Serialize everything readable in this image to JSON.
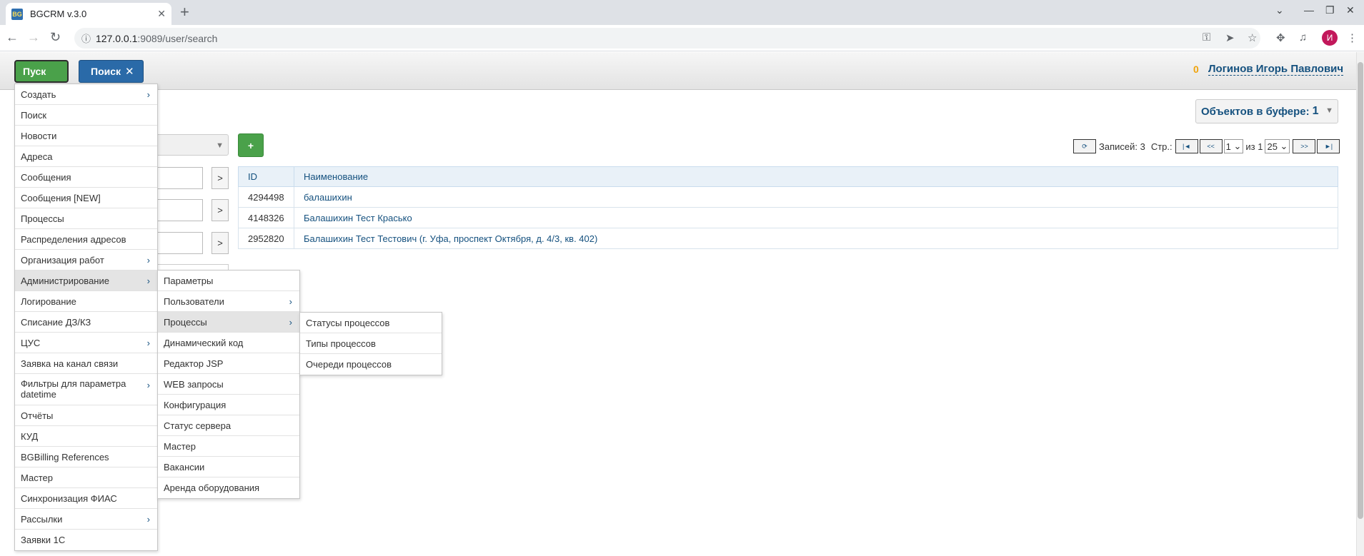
{
  "browser": {
    "tab_title": "BGCRM v.3.0",
    "favicon_text": "BG",
    "new_tab": "+",
    "url_host": "127.0.0.1",
    "url_rest": ":9089/user/search",
    "profile_initial": "И"
  },
  "header": {
    "start_label": "Пуск",
    "search_tab_label": "Поиск",
    "counter": "0",
    "user_name": "Логинов Игорь Павлович"
  },
  "buffer": {
    "label": "Объектов в буфере:",
    "count": "1"
  },
  "filter": {
    "add_label": "+",
    "go_label": ">"
  },
  "pager": {
    "records_label": "Записей: 3",
    "page_label": "Стр.:",
    "page_current": "1",
    "of_label": "из 1",
    "page_size": "25",
    "first": "|◄",
    "prev": "<<",
    "next": ">>",
    "last": "►|"
  },
  "table": {
    "headers": [
      "ID",
      "Наименование"
    ],
    "rows": [
      {
        "id": "4294498",
        "name": "балашихин"
      },
      {
        "id": "4148326",
        "name": "Балашихин Тест Красько"
      },
      {
        "id": "2952820",
        "name": "Балашихин Тест Тестович (г. Уфа, проспект Октября, д. 4/3, кв. 402)"
      }
    ]
  },
  "menu": {
    "main": [
      {
        "label": "Создать"
      },
      {
        "label": "Поиск"
      },
      {
        "label": "Новости"
      },
      {
        "label": "Адреса"
      },
      {
        "label": "Сообщения"
      },
      {
        "label": "Сообщения [NEW]"
      },
      {
        "label": "Процессы"
      },
      {
        "label": "Распределения адресов"
      },
      {
        "label": "Организация работ"
      },
      {
        "label": "Администрирование"
      },
      {
        "label": "Логирование"
      },
      {
        "label": "Списание ДЗ/КЗ"
      },
      {
        "label": "ЦУС"
      },
      {
        "label": "Заявка на канал связи"
      },
      {
        "label": "Фильтры для параметра datetime"
      },
      {
        "label": "Отчёты"
      },
      {
        "label": "КУД"
      },
      {
        "label": "BGBilling References"
      },
      {
        "label": "Мастер"
      },
      {
        "label": "Синхронизация ФИАС"
      },
      {
        "label": "Рассылки"
      },
      {
        "label": "Заявки 1С"
      }
    ],
    "admin": [
      {
        "label": "Параметры"
      },
      {
        "label": "Пользователи"
      },
      {
        "label": "Процессы"
      },
      {
        "label": "Динамический код"
      },
      {
        "label": "Редактор JSP"
      },
      {
        "label": "WEB запросы"
      },
      {
        "label": "Конфигурация"
      },
      {
        "label": "Статус сервера"
      },
      {
        "label": "Мастер"
      },
      {
        "label": "Вакансии"
      },
      {
        "label": "Аренда оборудования"
      }
    ],
    "processes": [
      {
        "label": "Статусы процессов"
      },
      {
        "label": "Типы процессов"
      },
      {
        "label": "Очереди процессов"
      }
    ]
  }
}
